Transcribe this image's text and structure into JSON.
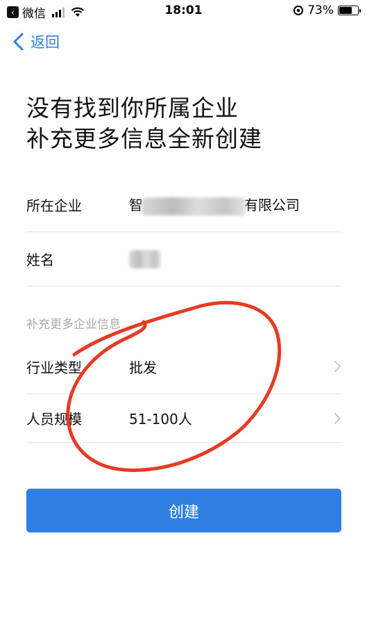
{
  "status_bar": {
    "back_app_label": "微信",
    "time": "18:01",
    "battery_pct": "73%",
    "battery_level": 0.73
  },
  "nav": {
    "back_label": "返回"
  },
  "heading": {
    "line1": "没有找到你所属企业",
    "line2": "补充更多信息全新创建"
  },
  "form": {
    "company": {
      "label": "所在企业",
      "value_prefix": "智",
      "value_suffix": "有限公司"
    },
    "name": {
      "label": "姓名",
      "value_prefix": ""
    },
    "section_title": "补充更多企业信息",
    "industry": {
      "label": "行业类型",
      "value": "批发"
    },
    "staff_size": {
      "label": "人员规模",
      "value": "51-100人"
    }
  },
  "actions": {
    "create_label": "创建"
  },
  "colors": {
    "accent": "#2f7ee1",
    "annotation": "#e53a24"
  },
  "icons": {
    "back": "chevron-left-icon",
    "row_arrow": "chevron-right-icon",
    "wifi": "wifi-icon",
    "signal": "signal-icon",
    "battery": "battery-icon",
    "rotation_lock": "rotation-lock-icon"
  }
}
